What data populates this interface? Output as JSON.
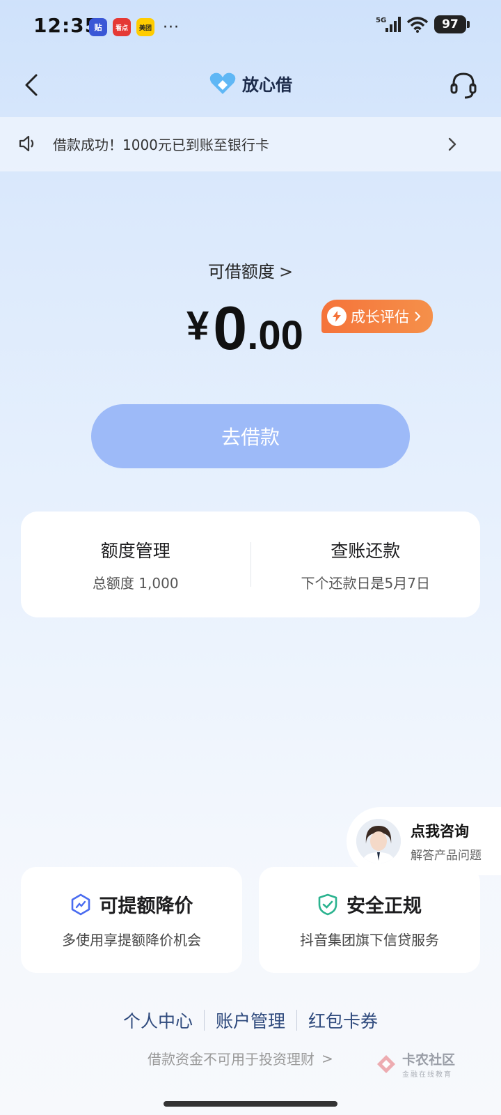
{
  "status_bar": {
    "time": "12:35",
    "apps": [
      {
        "label": "贴",
        "color": "#3a57d6"
      },
      {
        "label": "看点",
        "color": "#e53935"
      },
      {
        "label": "美团",
        "color": "#ffcc00"
      }
    ],
    "more": "···",
    "network": "5G",
    "battery": "97"
  },
  "nav": {
    "back_icon": "chevron-left-icon",
    "logo_text": "放心借",
    "service_icon": "headset-icon"
  },
  "notice": {
    "icon": "speaker-icon",
    "text": "借款成功！1000元已到账至银行卡",
    "arrow_icon": "chevron-right-icon"
  },
  "credit": {
    "label": "可借额度",
    "chevron": ">",
    "currency": "¥",
    "amount_int": "0",
    "amount_dot": ".",
    "amount_dec": "00",
    "growth_badge": "成长评估"
  },
  "borrow_button": "去借款",
  "quick_card": {
    "left": {
      "title": "额度管理",
      "subtitle": "总额度 1,000"
    },
    "right": {
      "title": "查账还款",
      "subtitle": "下个还款日是5月7日"
    }
  },
  "consult": {
    "title": "点我咨询",
    "subtitle": "解答产品问题"
  },
  "features": [
    {
      "icon": "trend-shield-icon",
      "title": "可提额降价",
      "subtitle": "多使用享提额降价机会",
      "icon_color": "#4a6cf0"
    },
    {
      "icon": "check-shield-icon",
      "title": "安全正规",
      "subtitle": "抖音集团旗下信贷服务",
      "icon_color": "#2bb38f"
    }
  ],
  "footer": {
    "links": [
      "个人中心",
      "账户管理",
      "红包卡券"
    ],
    "note": "借款资金不可用于投资理财",
    "note_arrow": ">"
  },
  "watermark": {
    "main": "卡农社区",
    "sub": "金融在线教育"
  },
  "colors": {
    "accent": "#9dbaf8",
    "badge": "#f5733a",
    "link": "#2f4a7d"
  }
}
